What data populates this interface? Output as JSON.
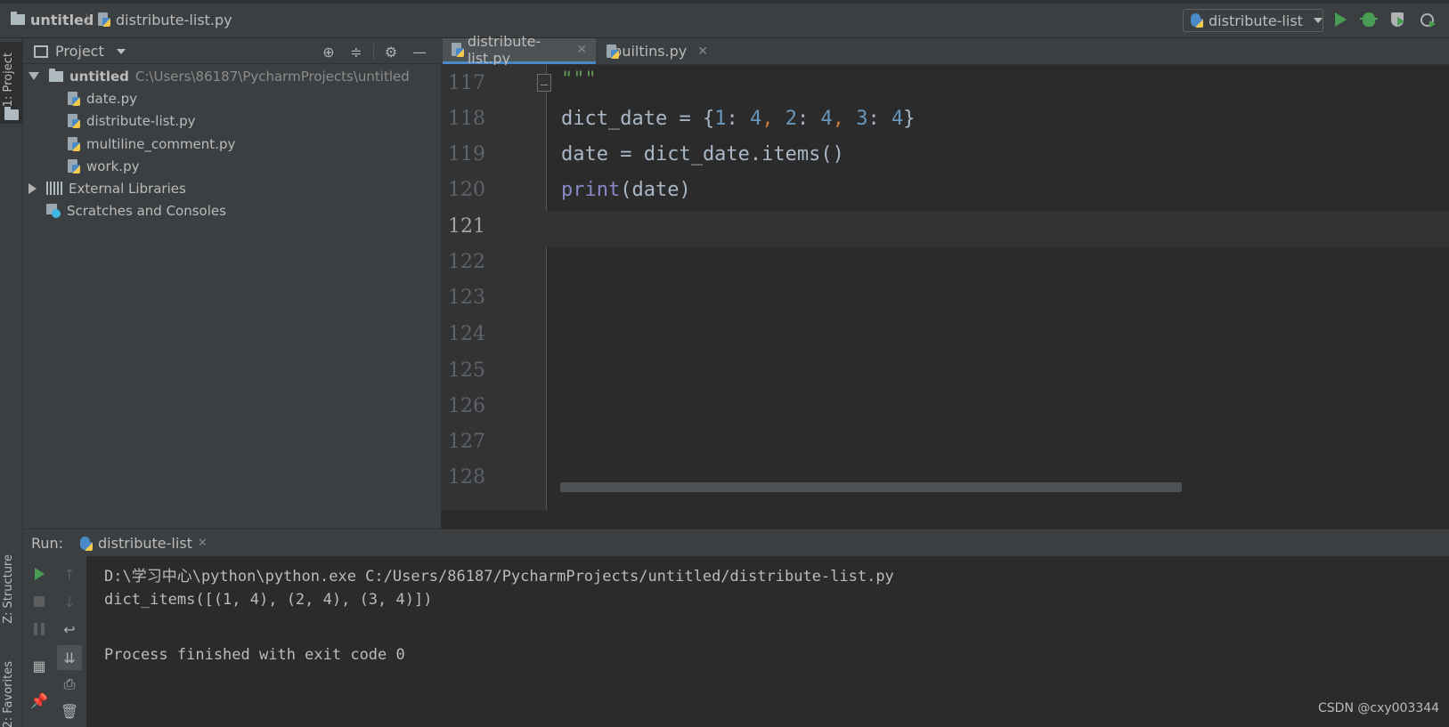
{
  "navbar": {
    "project": "untitled",
    "file": "distribute-list.py",
    "run_config": "distribute-list"
  },
  "left_strip": {
    "project_tab": "1: Project",
    "structure_tab": "Z: Structure",
    "favorites_tab": "2: Favorites"
  },
  "project_panel": {
    "title": "Project",
    "root": {
      "name": "untitled",
      "path": "C:\\Users\\86187\\PycharmProjects\\untitled"
    },
    "files": [
      "date.py",
      "distribute-list.py",
      "multiline_comment.py",
      "work.py"
    ],
    "external_libraries": "External Libraries",
    "scratches": "Scratches and Consoles"
  },
  "editor": {
    "tabs": [
      {
        "label": "distribute-list.py",
        "active": true
      },
      {
        "label": "builtins.py",
        "active": false
      }
    ],
    "line_numbers": [
      "117",
      "118",
      "119",
      "120",
      "121",
      "122",
      "123",
      "124",
      "125",
      "126",
      "127",
      "128"
    ],
    "current_line": "121",
    "code": {
      "l117": "\"\"\"",
      "l118": "dict_date = {1: 4, 2: 4, 3: 4}",
      "l119": "date = dict_date.items()",
      "l120": "print(date)"
    }
  },
  "run": {
    "label": "Run:",
    "tab": "distribute-list",
    "console": [
      "D:\\学习中心\\python\\python.exe C:/Users/86187/PycharmProjects/untitled/distribute-list.py",
      "dict_items([(1, 4), (2, 4), (3, 4)])",
      "",
      "Process finished with exit code 0"
    ]
  },
  "watermark": "CSDN @cxy003344",
  "colors": {
    "background": "#2b2b2b",
    "panel": "#3c3f41",
    "accent": "#4a88c7",
    "run_green": "#499c54",
    "number": "#6897bb",
    "comma": "#cc7832",
    "builtin": "#8888c6"
  }
}
